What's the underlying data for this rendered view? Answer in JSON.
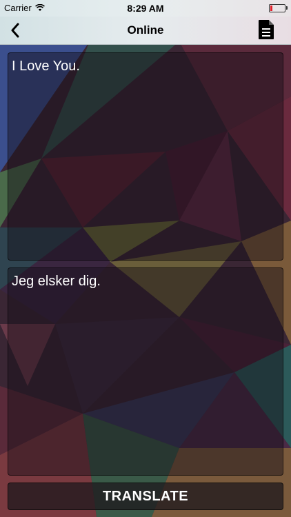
{
  "status_bar": {
    "carrier": "Carrier",
    "time": "8:29 AM",
    "wifi_icon": "wifi-icon",
    "battery_icon": "battery-low-icon",
    "battery_color": "#e0202a"
  },
  "nav": {
    "title": "Online",
    "back_icon": "chevron-left-icon",
    "document_icon": "document-icon"
  },
  "source": {
    "text": "I Love You."
  },
  "target": {
    "text": "Jeg elsker dig."
  },
  "translate_button": {
    "label": "TRANSLATE"
  }
}
